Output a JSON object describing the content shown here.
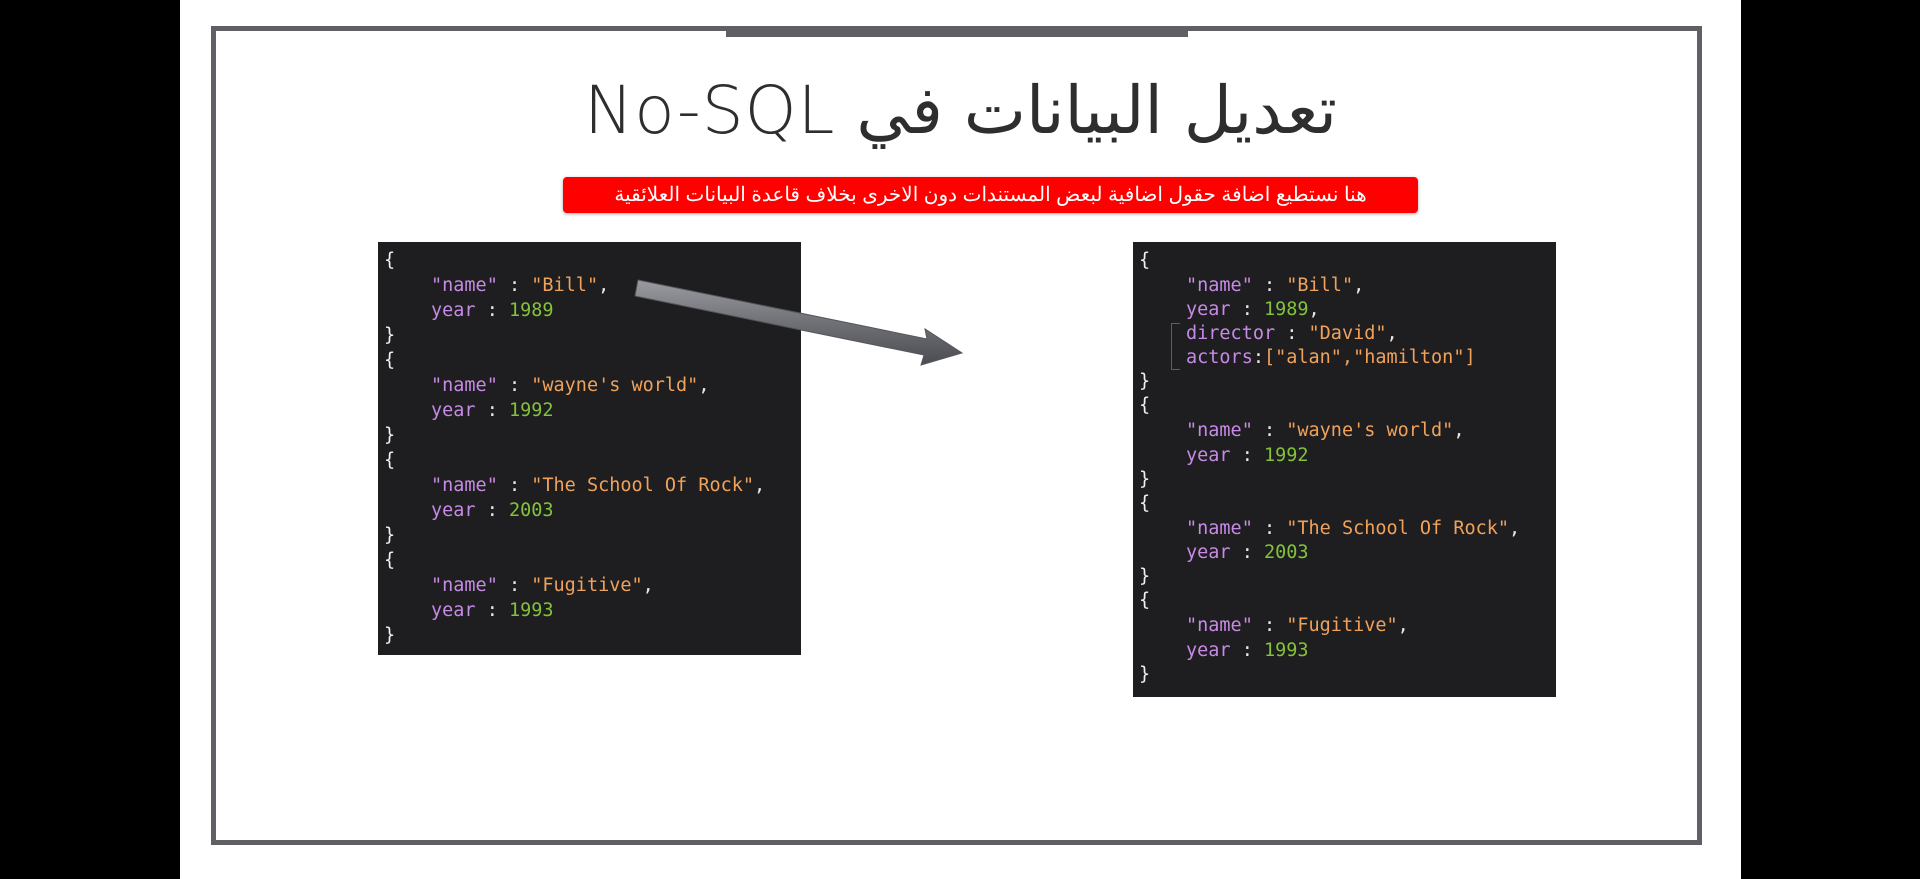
{
  "slide": {
    "title": "تعديل البيانات في No-SQL",
    "note": "هنا نستطيع اضافة حقول اضافية لبعض المستندات دون الاخرى بخلاف قاعدة البيانات العلائقية"
  },
  "left_code": {
    "documents": [
      {
        "name_key": "\"name\"",
        "name_value": "\"Bill\"",
        "year_key": "year",
        "year_value": "1989"
      },
      {
        "name_key": "\"name\"",
        "name_value": "\"wayne's world\"",
        "year_key": "year",
        "year_value": "1992"
      },
      {
        "name_key": "\"name\"",
        "name_value": "\"The School Of Rock\"",
        "year_key": "year",
        "year_value": "2003"
      },
      {
        "name_key": "\"name\"",
        "name_value": "\"Fugitive\"",
        "year_key": "year",
        "year_value": "1993"
      }
    ]
  },
  "right_code": {
    "documents": [
      {
        "name_key": "\"name\"",
        "name_value": "\"Bill\"",
        "year_key": "year",
        "year_value": "1989"
      },
      {
        "name_key": "\"name\"",
        "name_value": "\"wayne's world\"",
        "year_key": "year",
        "year_value": "1992"
      },
      {
        "name_key": "\"name\"",
        "name_value": "\"The School Of Rock\"",
        "year_key": "year",
        "year_value": "2003"
      },
      {
        "name_key": "\"name\"",
        "name_value": "\"Fugitive\"",
        "year_key": "year",
        "year_value": "1993"
      }
    ],
    "extra_fields": {
      "director_key": "director",
      "director_value": "\"David\"",
      "actors_key": "actors",
      "actors_value": "[\"alan\",\"hamilton\"]"
    }
  },
  "colors": {
    "frame": "#5f6066",
    "note_bg": "#ff0000",
    "code_bg": "#1e1e20",
    "key": "#c78ae6",
    "string": "#f0a25a",
    "number": "#83c23a",
    "highlight": "#e0262a"
  },
  "icons": {
    "arrow": "arrow-right-icon"
  }
}
